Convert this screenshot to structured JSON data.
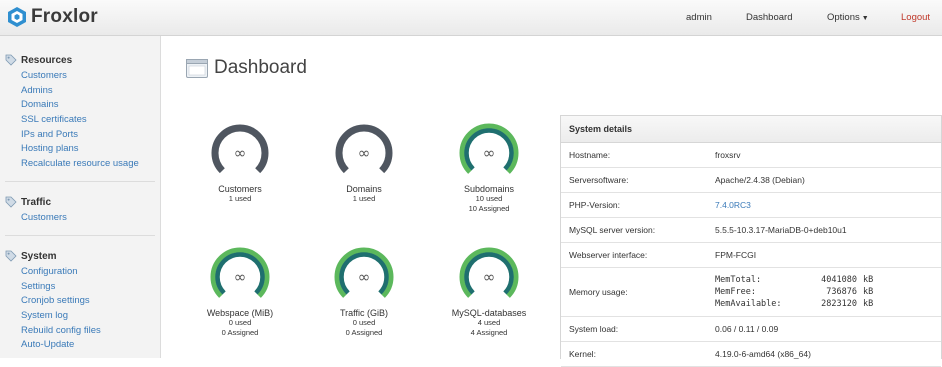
{
  "header": {
    "brand": "Froxlor",
    "user": "admin",
    "dashboard": "Dashboard",
    "options": "Options",
    "logout": "Logout"
  },
  "sidebar": {
    "resources": {
      "title": "Resources",
      "items": [
        "Customers",
        "Admins",
        "Domains",
        "SSL certificates",
        "IPs and Ports",
        "Hosting plans",
        "Recalculate resource usage"
      ]
    },
    "traffic": {
      "title": "Traffic",
      "items": [
        "Customers"
      ]
    },
    "system": {
      "title": "System",
      "items": [
        "Configuration",
        "Settings",
        "Cronjob settings",
        "System log",
        "Rebuild config files",
        "Auto-Update"
      ]
    }
  },
  "main": {
    "title": "Dashboard"
  },
  "gauges": [
    {
      "label": "Customers",
      "line1": "1 used",
      "line2": "",
      "symbol": "∞",
      "fill": 0
    },
    {
      "label": "Domains",
      "line1": "1 used",
      "line2": "",
      "symbol": "∞",
      "fill": 0
    },
    {
      "label": "Subdomains",
      "line1": "10 used",
      "line2": "10 Assigned",
      "symbol": "∞",
      "fill": 1
    },
    {
      "label": "Webspace (MiB)",
      "line1": "0 used",
      "line2": "0 Assigned",
      "symbol": "∞",
      "fill": 1
    },
    {
      "label": "Traffic (GiB)",
      "line1": "0 used",
      "line2": "0 Assigned",
      "symbol": "∞",
      "fill": 1
    },
    {
      "label": "MySQL-databases",
      "line1": "4 used",
      "line2": "4 Assigned",
      "symbol": "∞",
      "fill": 1
    }
  ],
  "system_details": {
    "title": "System details",
    "hostname": {
      "label": "Hostname:",
      "value": "froxsrv"
    },
    "serversoftware": {
      "label": "Serversoftware:",
      "value": "Apache/2.4.38 (Debian)"
    },
    "php": {
      "label": "PHP-Version:",
      "value": "7.4.0RC3"
    },
    "mysql": {
      "label": "MySQL server version:",
      "value": "5.5.5-10.3.17-MariaDB-0+deb10u1"
    },
    "webserver": {
      "label": "Webserver interface:",
      "value": "FPM-FCGI"
    },
    "memory": {
      "label": "Memory usage:",
      "lines": [
        {
          "key": "MemTotal:",
          "value": "4041080",
          "unit": "kB"
        },
        {
          "key": "MemFree:",
          "value": "736876",
          "unit": "kB"
        },
        {
          "key": "MemAvailable:",
          "value": "2823120",
          "unit": "kB"
        }
      ]
    },
    "load": {
      "label": "System load:",
      "value": "0.06 / 0.11 / 0.09"
    },
    "kernel": {
      "label": "Kernel:",
      "value": "4.19.0-6-amd64 (x86_64)"
    }
  },
  "colors": {
    "gauge_dark": "#4f5660",
    "gauge_green": "#5cb85c",
    "gauge_teal": "#1f6f6f",
    "link": "#3a7ab8",
    "logout": "#c0392b"
  }
}
